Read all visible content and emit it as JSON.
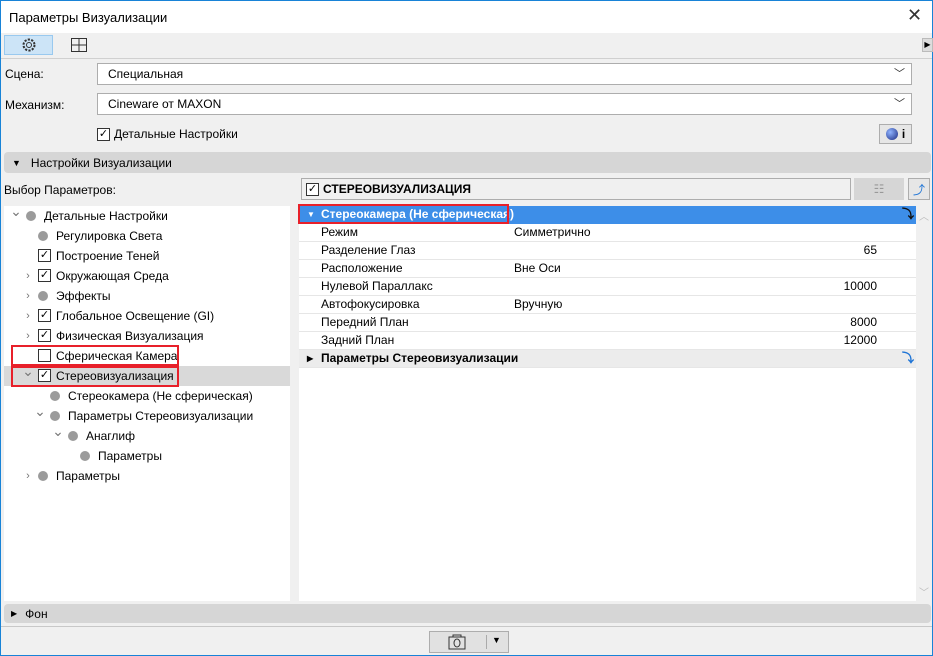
{
  "window": {
    "title": "Параметры Визуализации"
  },
  "toolbar": {
    "tabs": [
      {
        "icon": "gear-icon",
        "selected": true
      },
      {
        "icon": "grid-icon",
        "selected": false
      }
    ]
  },
  "scene": {
    "label": "Сцена:",
    "value": "Специальная"
  },
  "engine": {
    "label": "Механизм:",
    "value": "Cineware от MAXON"
  },
  "detailed": {
    "label": "Детальные Настройки",
    "checked": true,
    "info_label": "i"
  },
  "section": {
    "label": "Настройки Визуализации"
  },
  "tree": {
    "label": "Выбор Параметров:",
    "items": [
      {
        "label": "Детальные Настройки",
        "level": 0,
        "expander": "down",
        "mark": "dot"
      },
      {
        "label": "Регулировка Света",
        "level": 1,
        "expander": "",
        "mark": "dot"
      },
      {
        "label": "Построение Теней",
        "level": 1,
        "expander": "",
        "mark": "check"
      },
      {
        "label": "Окружающая Среда",
        "level": 1,
        "expander": "right",
        "mark": "check"
      },
      {
        "label": "Эффекты",
        "level": 1,
        "expander": "right",
        "mark": "dot"
      },
      {
        "label": "Глобальное Освещение (GI)",
        "level": 1,
        "expander": "right",
        "mark": "check"
      },
      {
        "label": "Физическая Визуализация",
        "level": 1,
        "expander": "right",
        "mark": "check"
      },
      {
        "label": "Сферическая Камера",
        "level": 1,
        "expander": "",
        "mark": "uncheck"
      },
      {
        "label": "Стереовизуализация",
        "level": 1,
        "expander": "down",
        "mark": "check",
        "selected": true
      },
      {
        "label": "Стереокамера (Не сферическая)",
        "level": 2,
        "expander": "",
        "mark": "dot"
      },
      {
        "label": "Параметры Стереовизуализации",
        "level": 2,
        "expander": "down",
        "mark": "dot"
      },
      {
        "label": "Анаглиф",
        "level": 3,
        "expander": "down",
        "mark": "dot"
      },
      {
        "label": "Параметры",
        "level": 4,
        "expander": "",
        "mark": "dot"
      },
      {
        "label": "Параметры",
        "level": 1,
        "expander": "right",
        "mark": "dot"
      }
    ]
  },
  "panel": {
    "title": "СТЕРЕОВИЗУАЛИЗАЦИЯ",
    "checked": true,
    "group": "Стереокамера (Не сферическая)",
    "rows": [
      {
        "key": "Режим",
        "value": "Симметрично",
        "num": ""
      },
      {
        "key": "Разделение Глаз",
        "value": "",
        "num": "65"
      },
      {
        "key": "Расположение",
        "value": "Вне Оси",
        "num": ""
      },
      {
        "key": "Нулевой Параллакс",
        "value": "",
        "num": "10000"
      },
      {
        "key": "Автофокусировка",
        "value": "Вручную",
        "num": ""
      },
      {
        "key": "Передний План",
        "value": "",
        "num": "8000"
      },
      {
        "key": "Задний План",
        "value": "",
        "num": "12000"
      }
    ],
    "subgroup": "Параметры Стереовизуализации"
  },
  "background": {
    "label": "Фон"
  },
  "colors": {
    "accent": "#3d8ee8",
    "highlight": "#e8202a"
  }
}
